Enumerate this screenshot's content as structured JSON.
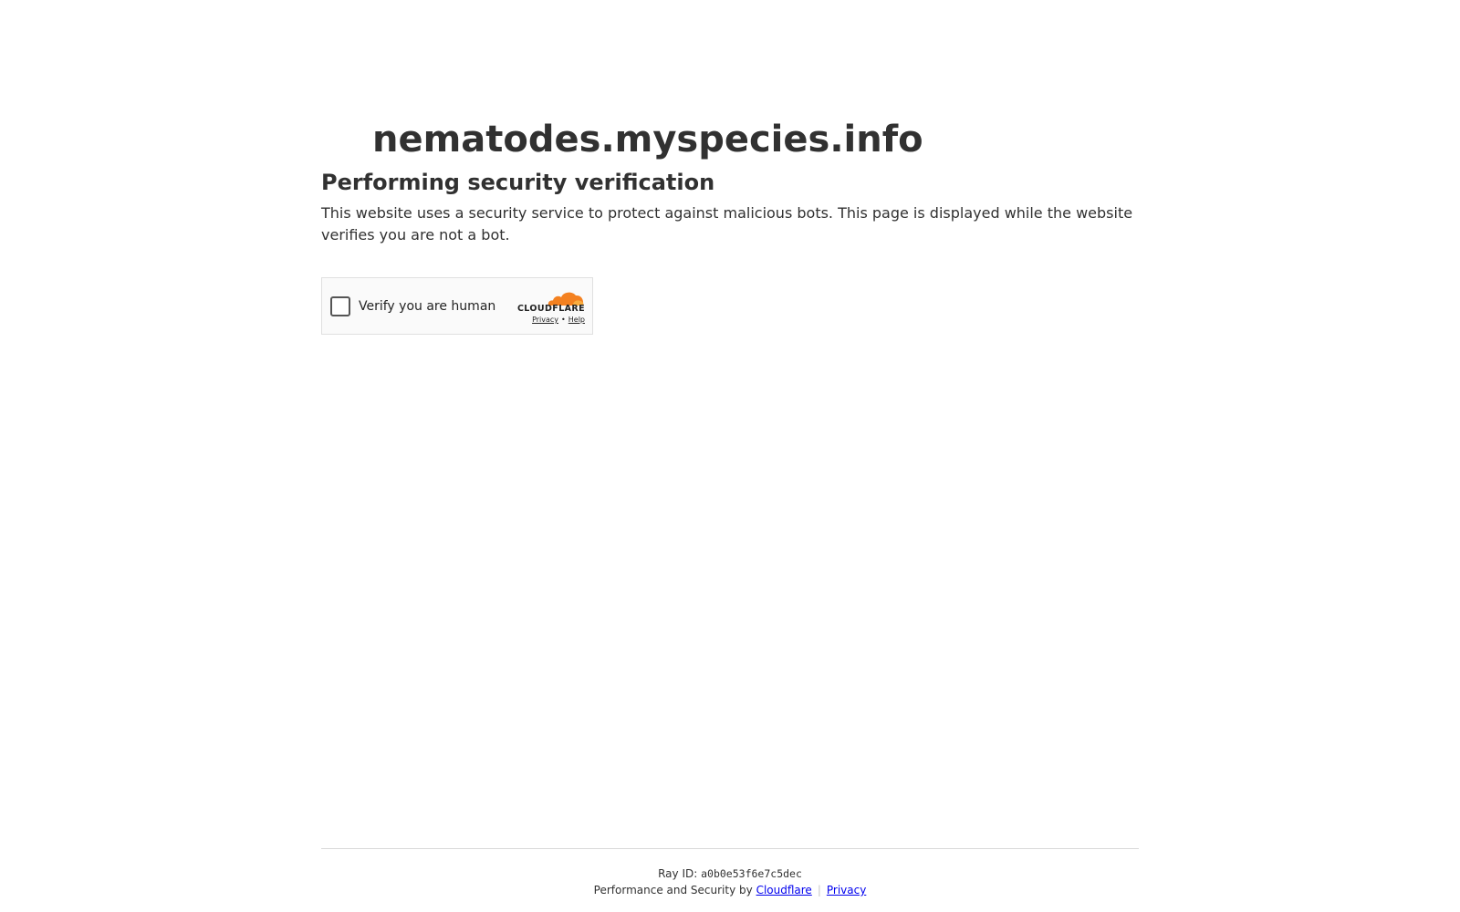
{
  "site": {
    "domain": "nematodes.myspecies.info"
  },
  "content": {
    "heading": "Performing security verification",
    "description": "This website uses a security service to protect against malicious bots. This page is displayed while the website verifies you are not a bot."
  },
  "widget": {
    "checkbox_label": "Verify you are human",
    "checked": false,
    "brand": "CLOUDFLARE",
    "brand_logo": "cloudflare-cloud-icon",
    "privacy_link": "Privacy",
    "separator": "•",
    "help_link": "Help"
  },
  "footer": {
    "ray_label": "Ray ID:",
    "ray_id": "a0b0e53f6e7c5dec",
    "perf_text": "Performance and Security by",
    "cloudflare_link": "Cloudflare",
    "pipe": "|",
    "privacy_link": "Privacy"
  },
  "colors": {
    "text": "#313131",
    "cloudflare_orange": "#f48120",
    "cloudflare_orange_light": "#faad3f",
    "link_blue": "#0000ee"
  }
}
